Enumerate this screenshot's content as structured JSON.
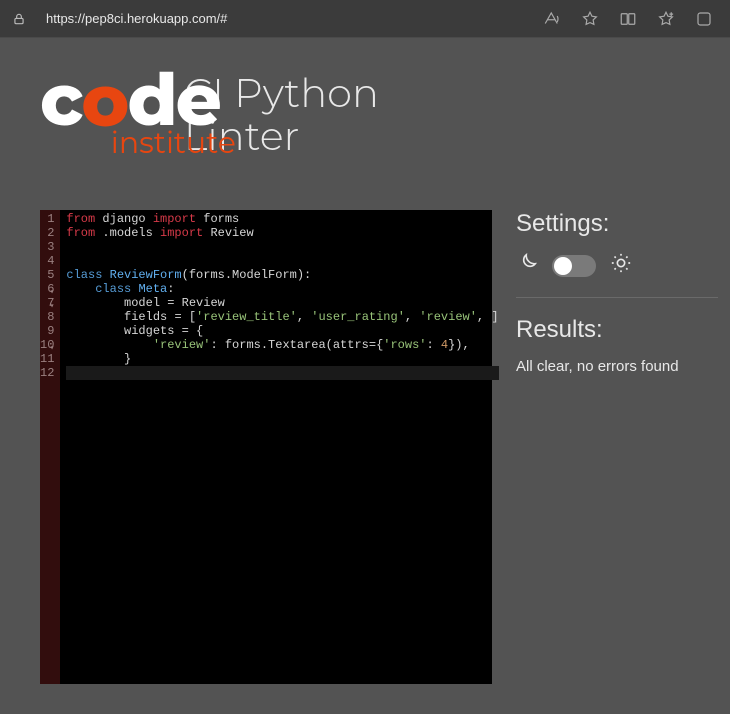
{
  "browser": {
    "url": "https://pep8ci.herokuapp.com/#"
  },
  "logo": {
    "c": "c",
    "o": "o",
    "de": "de",
    "institute": "institute"
  },
  "title": {
    "line1": "CI Python",
    "line2": "Linter"
  },
  "code_lines": [
    {
      "n": "1",
      "fold": "",
      "tokens": [
        [
          "kw-red",
          "from"
        ],
        [
          "name",
          " django "
        ],
        [
          "kw-red",
          "import"
        ],
        [
          "name",
          " forms"
        ]
      ]
    },
    {
      "n": "2",
      "fold": "",
      "tokens": [
        [
          "kw-red",
          "from"
        ],
        [
          "name",
          " .models "
        ],
        [
          "kw-red",
          "import"
        ],
        [
          "name",
          " Review"
        ]
      ]
    },
    {
      "n": "3",
      "fold": "",
      "tokens": []
    },
    {
      "n": "4",
      "fold": "",
      "tokens": []
    },
    {
      "n": "5",
      "fold": "▾",
      "tokens": [
        [
          "cls",
          "class"
        ],
        [
          "name",
          " "
        ],
        [
          "type",
          "ReviewForm"
        ],
        [
          "name",
          "(forms.ModelForm):"
        ]
      ]
    },
    {
      "n": "6",
      "fold": "▾",
      "tokens": [
        [
          "name",
          "    "
        ],
        [
          "cls",
          "class"
        ],
        [
          "name",
          " "
        ],
        [
          "type",
          "Meta"
        ],
        [
          "name",
          ":"
        ]
      ]
    },
    {
      "n": "7",
      "fold": "",
      "tokens": [
        [
          "name",
          "        model "
        ],
        [
          "op",
          "="
        ],
        [
          "name",
          " Review"
        ]
      ]
    },
    {
      "n": "8",
      "fold": "",
      "tokens": [
        [
          "name",
          "        fields "
        ],
        [
          "op",
          "="
        ],
        [
          "name",
          " ["
        ],
        [
          "str",
          "'review_title'"
        ],
        [
          "name",
          ", "
        ],
        [
          "str",
          "'user_rating'"
        ],
        [
          "name",
          ", "
        ],
        [
          "str",
          "'review'"
        ],
        [
          "name",
          ", ]"
        ]
      ]
    },
    {
      "n": "9",
      "fold": "▾",
      "tokens": [
        [
          "name",
          "        widgets "
        ],
        [
          "op",
          "="
        ],
        [
          "name",
          " {"
        ]
      ]
    },
    {
      "n": "10",
      "fold": "",
      "tokens": [
        [
          "name",
          "            "
        ],
        [
          "str",
          "'review'"
        ],
        [
          "name",
          ": forms.Textarea(attrs={"
        ],
        [
          "str",
          "'rows'"
        ],
        [
          "name",
          ": "
        ],
        [
          "num",
          "4"
        ],
        [
          "name",
          "}),"
        ]
      ]
    },
    {
      "n": "11",
      "fold": "",
      "tokens": [
        [
          "name",
          "        }"
        ]
      ]
    },
    {
      "n": "12",
      "fold": "",
      "tokens": []
    }
  ],
  "sidebar": {
    "settings_title": "Settings:",
    "results_title": "Results:",
    "results_text": "All clear, no errors found"
  }
}
